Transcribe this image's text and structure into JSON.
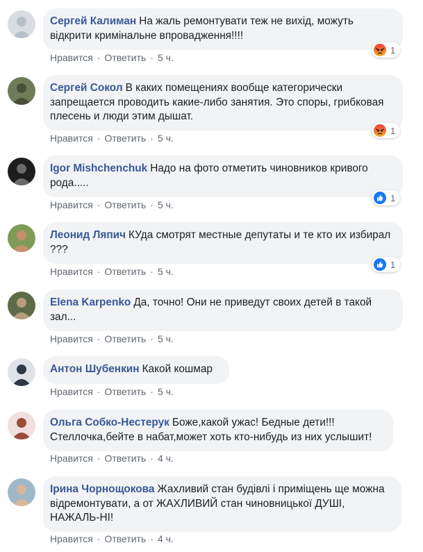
{
  "labels": {
    "like": "Нравится",
    "reply": "Ответить",
    "dot": "·"
  },
  "comments": [
    {
      "author": "Сергей Калиман",
      "text": "На жаль ремонтувати теж не вихід, можуть відкрити кримінальне впровадження!!!!",
      "time": "5 ч.",
      "reaction": {
        "type": "angry",
        "count": "1"
      }
    },
    {
      "author": "Сергей Сокол",
      "text": "В каких помещениях вообще категорически запрещается проводить какие-либо занятия. Это споры, грибковая плесень и люди этим дышат.",
      "time": "5 ч.",
      "reaction": {
        "type": "angry",
        "count": "1"
      }
    },
    {
      "author": "Igor Mishchenchuk",
      "text": "Надо на фото отметить чиновников кривого рода.....",
      "time": "5 ч.",
      "reaction": {
        "type": "like",
        "count": "1"
      }
    },
    {
      "author": "Леонид Ляпич",
      "text": "КУда смотрят местные депутаты и те кто их избирал ???",
      "time": "5 ч.",
      "reaction": {
        "type": "like",
        "count": "1"
      }
    },
    {
      "author": "Elena Karpenko",
      "text": "Да, точно! Они не приведут своих детей в такой зал...",
      "time": "5 ч.",
      "reaction": null
    },
    {
      "author": "Антон Шубенкин",
      "text": "Какой кошмар",
      "time": "5 ч.",
      "reaction": null
    },
    {
      "author": "Ольга Собко-Нестерук",
      "text": "Боже,какой ужас! Бедные дети!!! Стеллочка,бейте в набат,может хоть кто-нибудь из них услышит!",
      "time": "4 ч.",
      "reaction": null
    },
    {
      "author": "Ірина Чорнощокова",
      "text": "Жахливий стан будівлі і приміщень ще можна відремонтувати, а от ЖАХЛИВИЙ стан чиновницької ДУШІ, НАЖАЛЬ-НІ!",
      "time": "4 ч.",
      "reaction": null
    }
  ],
  "colors": {
    "author": "#385898",
    "bubble": "#f2f3f5",
    "meta": "#606770",
    "like_blue": "#1877f2",
    "angry_top": "#f0383b",
    "angry_bottom": "#f7b125"
  }
}
